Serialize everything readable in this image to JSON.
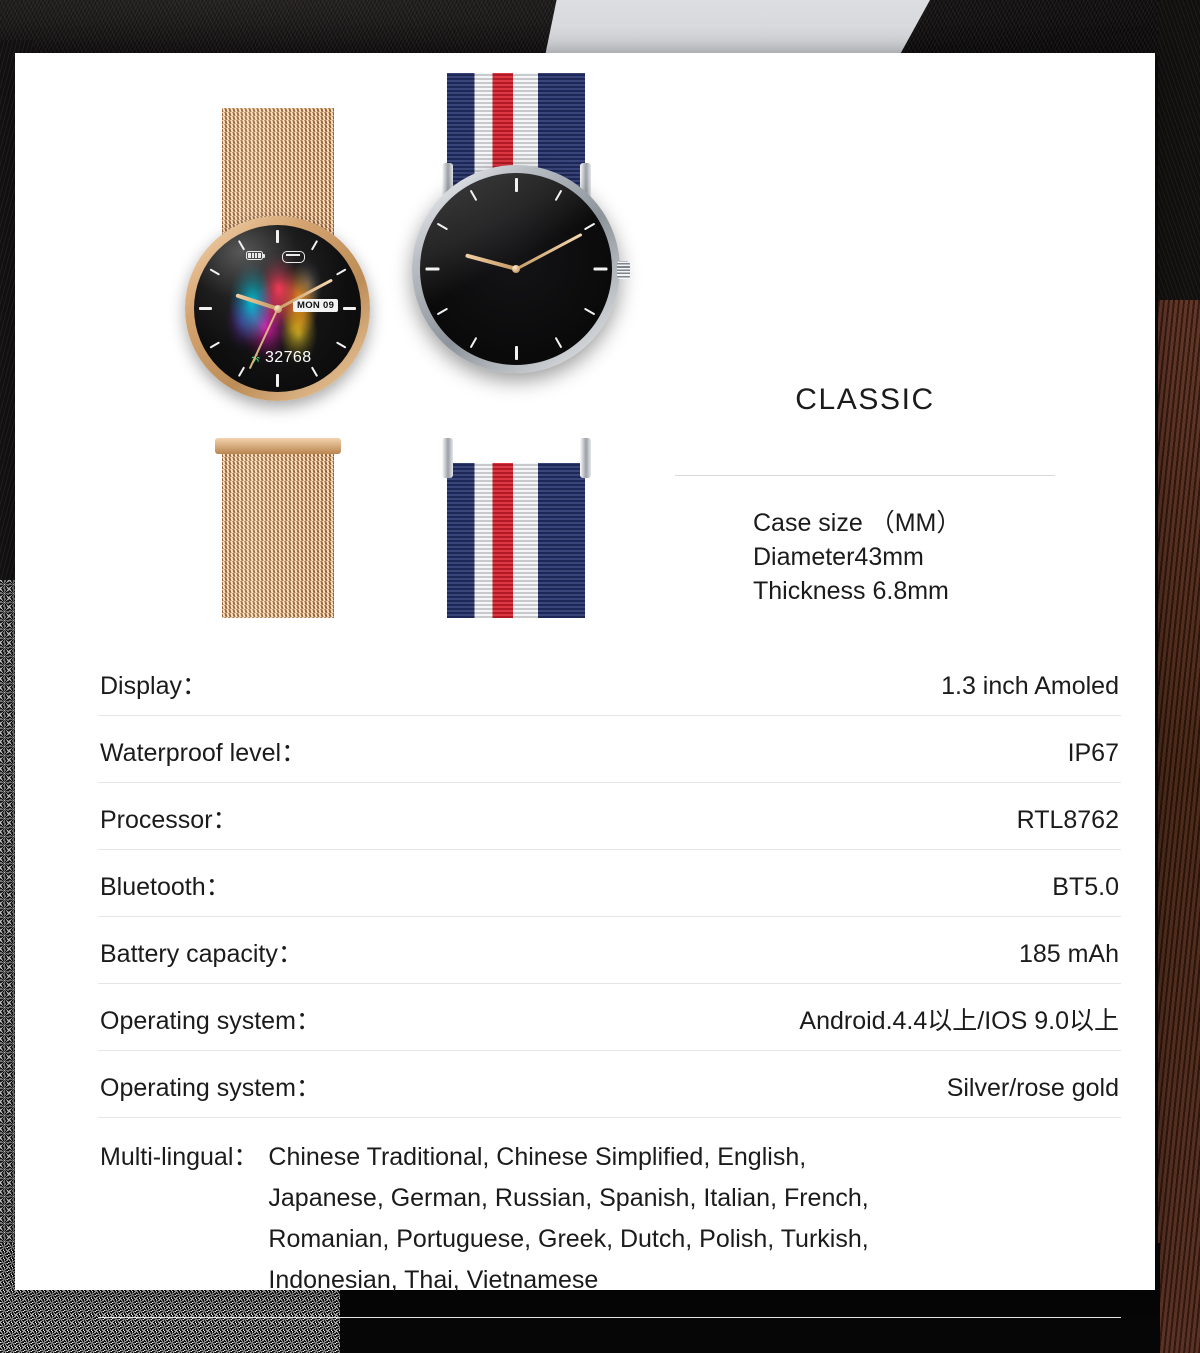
{
  "product": {
    "title": "CLASSIC",
    "case_size_lines": [
      "Case size （MM）",
      "Diameter43mm",
      "Thickness 6.8mm"
    ]
  },
  "watch_left": {
    "strap": "rose gold milanese mesh",
    "day_indicator": "MON 09",
    "steps": "32768",
    "battery_icon": "battery-icon",
    "link_icon": "bluetooth-link-icon",
    "runner_icon": "runner-icon"
  },
  "watch_right": {
    "strap": "navy white red NATO",
    "case": "silver"
  },
  "specs": [
    {
      "label": "Display：",
      "value": "1.3 inch Amoled"
    },
    {
      "label": "Waterproof level：",
      "value": "IP67"
    },
    {
      "label": "Processor：",
      "value": "RTL8762"
    },
    {
      "label": "Bluetooth：",
      "value": "BT5.0"
    },
    {
      "label": "Battery capacity：",
      "value": "185 mAh"
    },
    {
      "label": "Operating system：",
      "value": "Android.4.4以上/IOS 9.0以上"
    },
    {
      "label": "Operating system：",
      "value": "Silver/rose gold"
    }
  ],
  "multilingual": {
    "label": "Multi-lingual：",
    "lines": [
      "Chinese Traditional, Chinese Simplified, English,",
      "Japanese, German, Russian, Spanish, Italian, French,",
      "Romanian, Portuguese, Greek, Dutch, Polish, Turkish,",
      "Indonesian, Thai, Vietnamese"
    ]
  },
  "colors": {
    "card": "#ffffff",
    "text": "#1b1b1b",
    "rule": "#e6e6e6",
    "rose_gold": "#d5a471",
    "silver": "#b9bec4",
    "nato_navy": "#24316b",
    "nato_red": "#d8202c",
    "steps_accent": "#29e06a",
    "wood": "#43200f"
  }
}
